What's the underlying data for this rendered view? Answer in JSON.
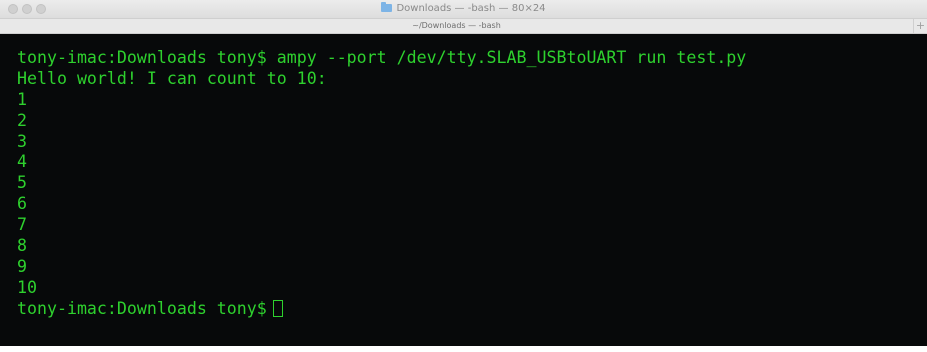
{
  "window": {
    "title": "Downloads — -bash — 80×24",
    "tab_title": "~/Downloads — -bash",
    "new_tab": "+"
  },
  "terminal": {
    "lines": [
      "tony-imac:Downloads tony$ ampy --port /dev/tty.SLAB_USBtoUART run test.py",
      "Hello world! I can count to 10:",
      "1",
      "2",
      "3",
      "4",
      "5",
      "6",
      "7",
      "8",
      "9",
      "10"
    ],
    "prompt": "tony-imac:Downloads tony$"
  },
  "colors": {
    "terminal_background": "#07090a",
    "terminal_text": "#2ed12e"
  },
  "icons": {
    "title_icon": "folder-icon"
  }
}
